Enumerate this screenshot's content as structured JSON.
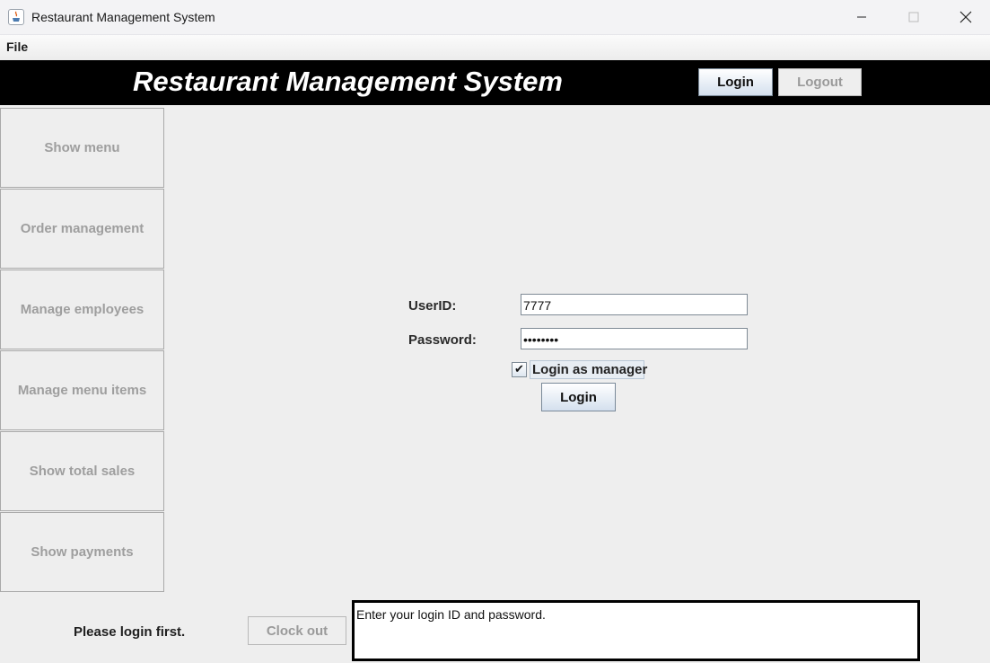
{
  "window": {
    "title": "Restaurant Management System",
    "icon": "java-coffee-icon",
    "controls": [
      "minimize-icon",
      "maximize-icon",
      "close-icon"
    ]
  },
  "menubar": {
    "items": [
      {
        "label": "File"
      }
    ]
  },
  "header": {
    "title": "Restaurant Management System",
    "login_label": "Login",
    "logout_label": "Logout",
    "logout_enabled": false
  },
  "sidebar": {
    "enabled": false,
    "items": [
      {
        "label": "Show menu"
      },
      {
        "label": "Order management"
      },
      {
        "label": "Manage employees"
      },
      {
        "label": "Manage menu items"
      },
      {
        "label": "Show total sales"
      },
      {
        "label": "Show payments"
      }
    ]
  },
  "login_form": {
    "userid_label": "UserID:",
    "userid_value": "7777",
    "password_label": "Password:",
    "password_value": "••••••••",
    "manager_checkbox_label": "Login as manager",
    "manager_checked": true,
    "check_mark": "✔",
    "login_button_label": "Login"
  },
  "footer": {
    "status_text": "Please login first.",
    "clock_out_label": "Clock out",
    "clock_out_enabled": false,
    "message": "Enter your login ID and password."
  },
  "colors": {
    "header_bg": "#000000",
    "header_text": "#ffffff",
    "disabled_text": "#9e9e9e",
    "window_bg": "#eeeeee"
  }
}
